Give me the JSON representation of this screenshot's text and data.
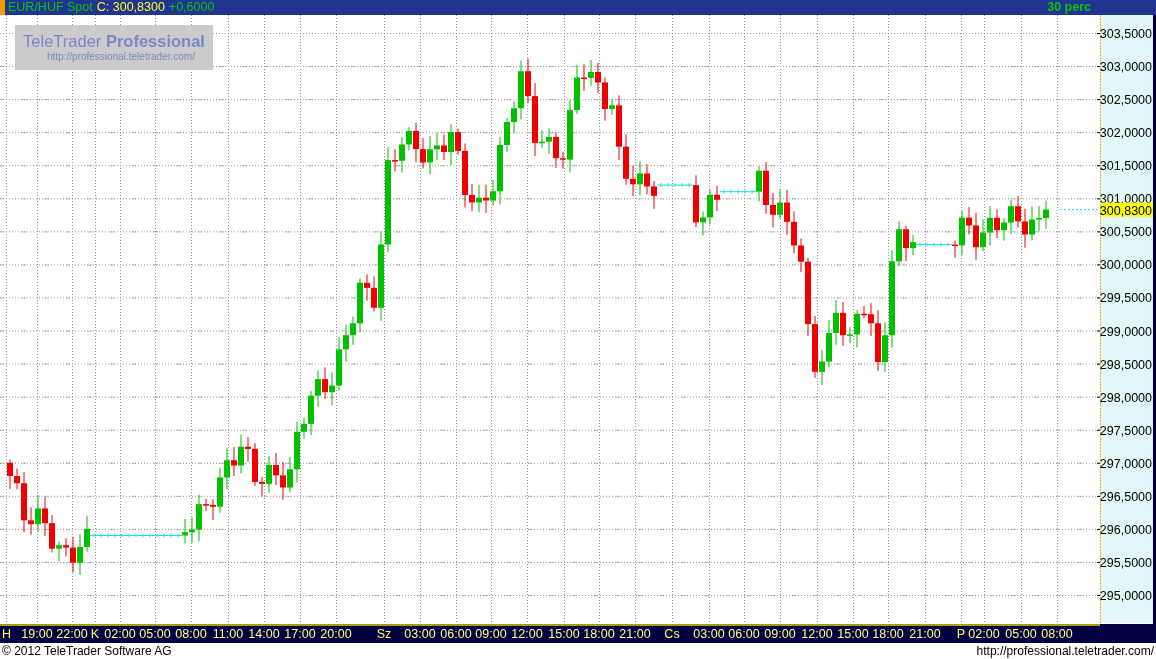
{
  "header": {
    "instrument": "EUR/HUF Spot",
    "close": "C: 300,8300",
    "change": "+0,6000",
    "interval": "30 perc"
  },
  "logo": {
    "title": "TeleTrader **Professional**",
    "url": "http://professional.teletrader.com/"
  },
  "price_axis": {
    "labels": [
      "303,5000",
      "303,0000",
      "302,5000",
      "302,0000",
      "301,5000",
      "301,0000",
      "300,5000",
      "300,0000",
      "299,5000",
      "299,0000",
      "298,5000",
      "298,0000",
      "297,5000",
      "297,0000",
      "296,5000",
      "296,0000",
      "295,5000",
      "295,0000"
    ],
    "last_price": "300,8300"
  },
  "time_axis": {
    "labels": [
      {
        "text": "H",
        "kind": "day"
      },
      {
        "text": "19:00",
        "kind": "hour"
      },
      {
        "text": "22:00",
        "kind": "hour"
      },
      {
        "text": "K",
        "kind": "day"
      },
      {
        "text": "02:00",
        "kind": "hour"
      },
      {
        "text": "05:00",
        "kind": "hour"
      },
      {
        "text": "08:00",
        "kind": "hour"
      },
      {
        "text": "11:00",
        "kind": "hour"
      },
      {
        "text": "14:00",
        "kind": "hour"
      },
      {
        "text": "17:00",
        "kind": "hour"
      },
      {
        "text": "20:00",
        "kind": "hour"
      },
      {
        "text": "Sz",
        "kind": "day"
      },
      {
        "text": "03:00",
        "kind": "hour"
      },
      {
        "text": "06:00",
        "kind": "hour"
      },
      {
        "text": "09:00",
        "kind": "hour"
      },
      {
        "text": "12:00",
        "kind": "hour"
      },
      {
        "text": "15:00",
        "kind": "hour"
      },
      {
        "text": "18:00",
        "kind": "hour"
      },
      {
        "text": "21:00",
        "kind": "hour"
      },
      {
        "text": "Cs",
        "kind": "day"
      },
      {
        "text": "03:00",
        "kind": "hour"
      },
      {
        "text": "06:00",
        "kind": "hour"
      },
      {
        "text": "09:00",
        "kind": "hour"
      },
      {
        "text": "12:00",
        "kind": "hour"
      },
      {
        "text": "15:00",
        "kind": "hour"
      },
      {
        "text": "18:00",
        "kind": "hour"
      },
      {
        "text": "21:00",
        "kind": "hour"
      },
      {
        "text": "P",
        "kind": "day"
      },
      {
        "text": "02:00",
        "kind": "hour"
      },
      {
        "text": "05:00",
        "kind": "hour"
      },
      {
        "text": "08:00",
        "kind": "hour"
      }
    ]
  },
  "footer": {
    "copyright": "© 2012 TeleTrader Software AG",
    "url": "http://professional.teletrader.com/"
  }
}
